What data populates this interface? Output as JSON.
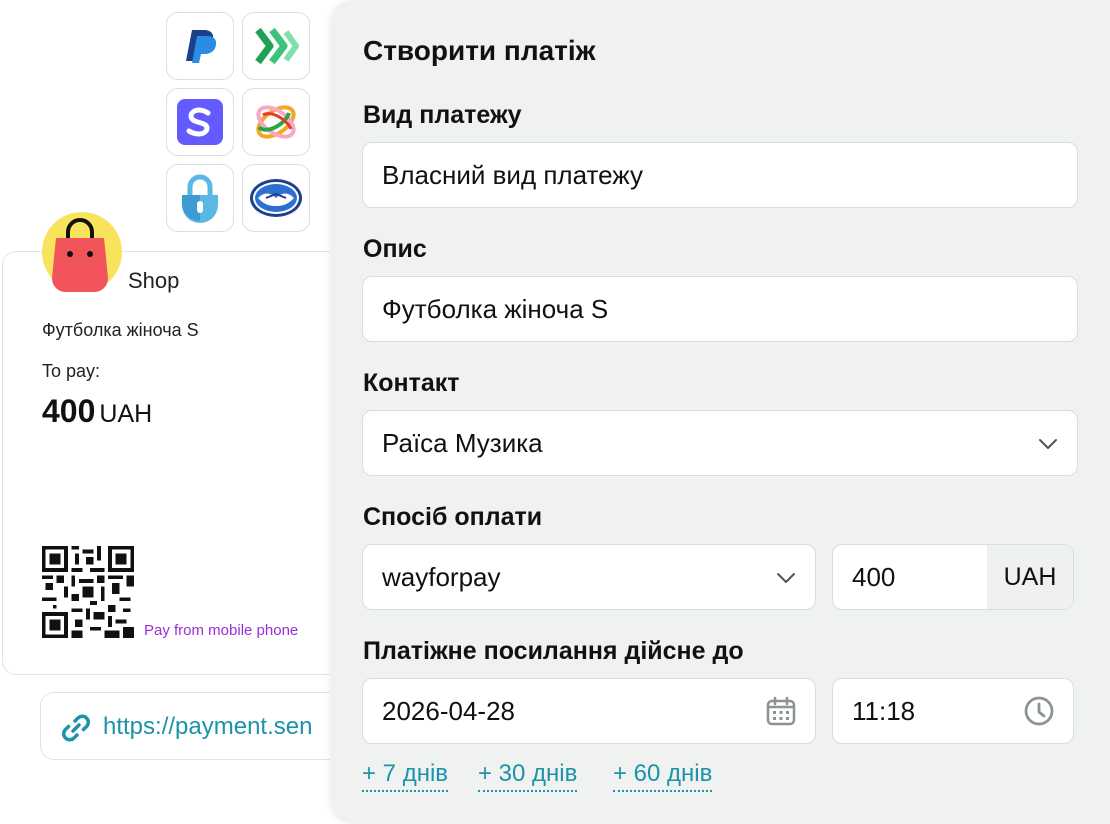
{
  "providers": [
    {
      "name": "paypal-icon"
    },
    {
      "name": "green-arrows-icon"
    },
    {
      "name": "stripe-s-icon"
    },
    {
      "name": "ring-logo-icon"
    },
    {
      "name": "lock-icon"
    },
    {
      "name": "handshake-icon"
    }
  ],
  "receipt": {
    "shop_name": "Shop",
    "product": "Футболка жіноча S",
    "to_pay_label": "To pay:",
    "amount": "400",
    "currency": "UAH",
    "mobile_label": "Pay from mobile phone",
    "link": "https://payment.sen"
  },
  "form": {
    "title": "Створити платіж",
    "payment_type_label": "Вид платежу",
    "payment_type_value": "Власний вид платежу",
    "description_label": "Опис",
    "description_value": "Футболка жіноча S",
    "contact_label": "Контакт",
    "contact_value": "Раїса Музика",
    "method_label": "Спосіб оплати",
    "method_value": "wayforpay",
    "amount_value": "400",
    "amount_currency": "UAH",
    "valid_until_label": "Платіжне посилання дійсне до",
    "date_value": "2026-04-28",
    "time_value": "11:18",
    "quick_options": [
      "+ 7 днів",
      "+ 30 днів",
      "+ 60 днів"
    ]
  },
  "colors": {
    "accent_link": "#1b93a8",
    "mobile_text": "#9b2fd6",
    "panel_bg": "#eff2f1"
  }
}
